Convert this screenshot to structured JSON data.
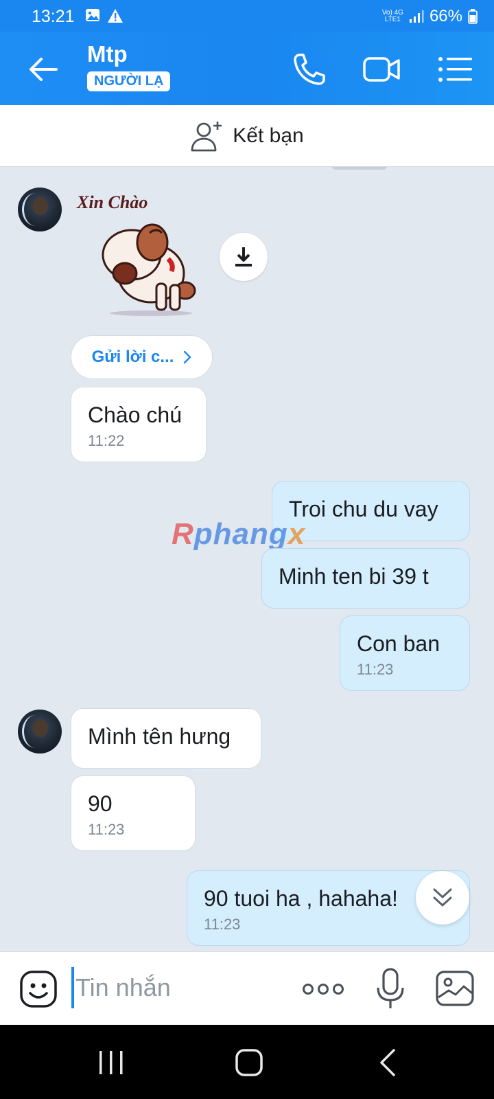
{
  "status_bar": {
    "time": "13:21",
    "network_top": "Vo) 4G",
    "network_bottom": "LTE1",
    "battery": "66%",
    "icons": [
      "image-icon",
      "warning-icon",
      "signal-icon",
      "battery-icon"
    ]
  },
  "header": {
    "name": "Mtp",
    "badge": "NGƯỜI LẠ",
    "icons": [
      "back-arrow-icon",
      "phone-icon",
      "video-camera-icon",
      "menu-list-icon"
    ]
  },
  "add_friend": {
    "label": "Kết bạn",
    "icon": "add-user-icon"
  },
  "chat": {
    "quick_reply": "Gửi lời c...",
    "messages": [
      {
        "side": "in",
        "text": "Chào chú",
        "time": "11:22"
      },
      {
        "side": "out",
        "text": "Troi chu du vay",
        "time": ""
      },
      {
        "side": "out",
        "text": "Minh ten bi 39 t",
        "time": ""
      },
      {
        "side": "out",
        "text": "Con ban",
        "time": "11:23"
      },
      {
        "side": "in",
        "text": "Mình tên hưng",
        "time": ""
      },
      {
        "side": "in",
        "text": "90",
        "time": "11:23"
      },
      {
        "side": "out",
        "text": "90 tuoi ha , hahaha!",
        "time": "11:23"
      }
    ],
    "sticker_text": "Xin Chào",
    "watermark": {
      "part_a": "R",
      "part_b": "phang",
      "part_c": "x"
    }
  },
  "input_bar": {
    "placeholder": "Tin nhắn",
    "icons": [
      "emoji-icon",
      "more-dots-icon",
      "microphone-icon",
      "image-gallery-icon"
    ]
  },
  "nav_bar": {
    "icons": [
      "recent-apps-icon",
      "home-icon",
      "back-icon"
    ]
  },
  "colors": {
    "brand_blue": "#1a86f0",
    "chat_background": "#e2e8f0",
    "outgoing_bubble": "#d4eefe",
    "incoming_bubble": "#ffffff"
  }
}
